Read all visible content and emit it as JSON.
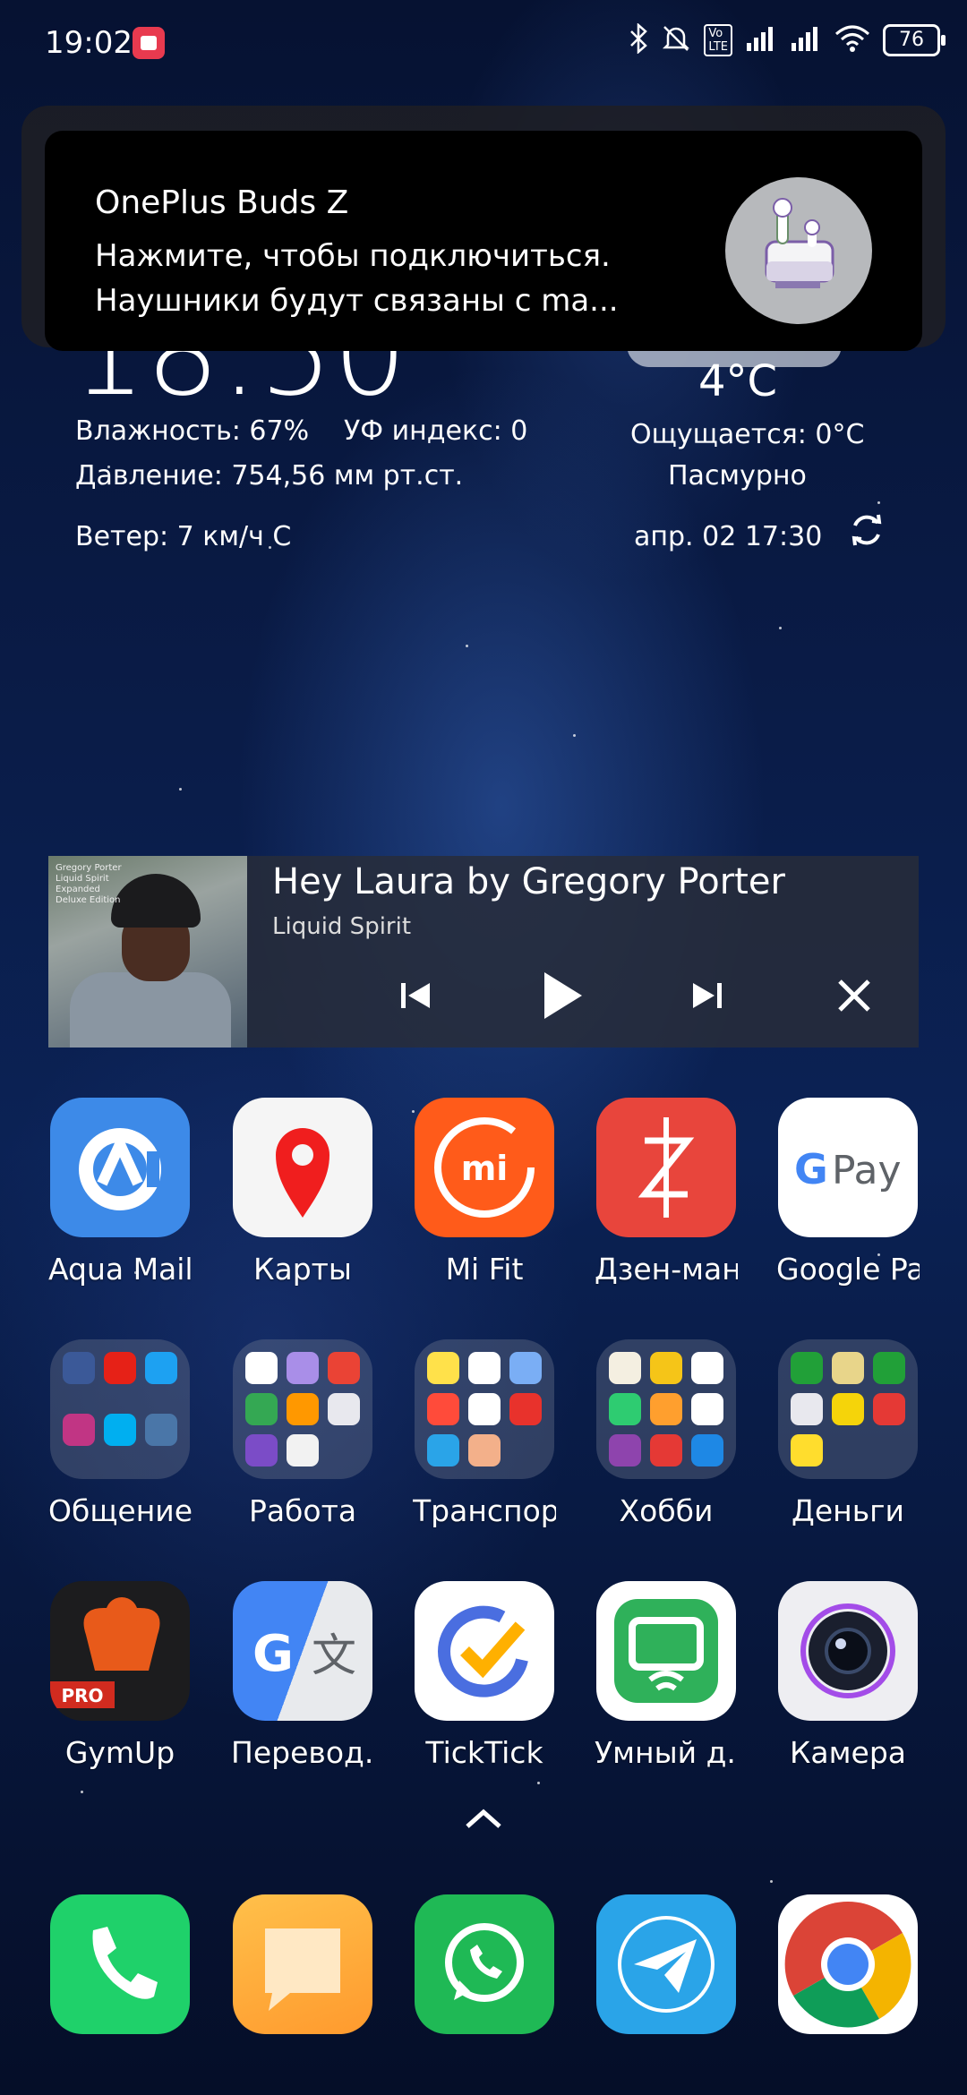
{
  "status_bar": {
    "time": "19:02",
    "battery": "76",
    "network_badge": "VoLTE"
  },
  "notification": {
    "title": "OnePlus Buds Z",
    "line1": "Нажмите, чтобы подключиться.",
    "line2": "Наушники будут связаны с ma..."
  },
  "weather": {
    "clock": "18:50",
    "humidity": "Влажность: 67%",
    "uv": "УФ индекс: 0",
    "pressure": "Давление: 754,56 мм рт.ст.",
    "wind": "Ветер: 7 км/ч С",
    "temperature": "4°C",
    "feels_like": "Ощущается: 0°C",
    "condition": "Пасмурно",
    "updated": "апр. 02  17:30"
  },
  "music": {
    "title": "Hey Laura by Gregory Porter",
    "album": "Liquid Spirit",
    "album_art_text": "Gregory Porter Liquid Spirit Expanded Deluxe Edition"
  },
  "apps_row1": [
    {
      "label": "Aqua Mail"
    },
    {
      "label": "Карты"
    },
    {
      "label": "Mi Fit"
    },
    {
      "label": "Дзен-мани"
    },
    {
      "label": "Google Pay"
    }
  ],
  "folders_row2": [
    {
      "label": "Общение"
    },
    {
      "label": "Работа"
    },
    {
      "label": "Транспорт"
    },
    {
      "label": "Хобби"
    },
    {
      "label": "Деньги"
    }
  ],
  "apps_row3": [
    {
      "label": "GymUp",
      "badge": "PRO"
    },
    {
      "label": "Перевод..."
    },
    {
      "label": "TickTick"
    },
    {
      "label": "Умный д..."
    },
    {
      "label": "Камера"
    }
  ],
  "colors": {
    "aqua_mail": "#3d8ae8",
    "mi_fit": "#ff5b1a",
    "zen_money": "#e8453c",
    "gymup": "#e85a1a",
    "tick": "#4a6ee0",
    "smart_home": "#2fb15a",
    "phone": "#1fd16a",
    "messages": "#ffb13a",
    "whatsapp": "#1fb955",
    "telegram": "#2aa4e8"
  },
  "icons": {
    "dock": [
      "phone-icon",
      "messages-icon",
      "whatsapp-icon",
      "telegram-icon",
      "chrome-icon"
    ]
  }
}
